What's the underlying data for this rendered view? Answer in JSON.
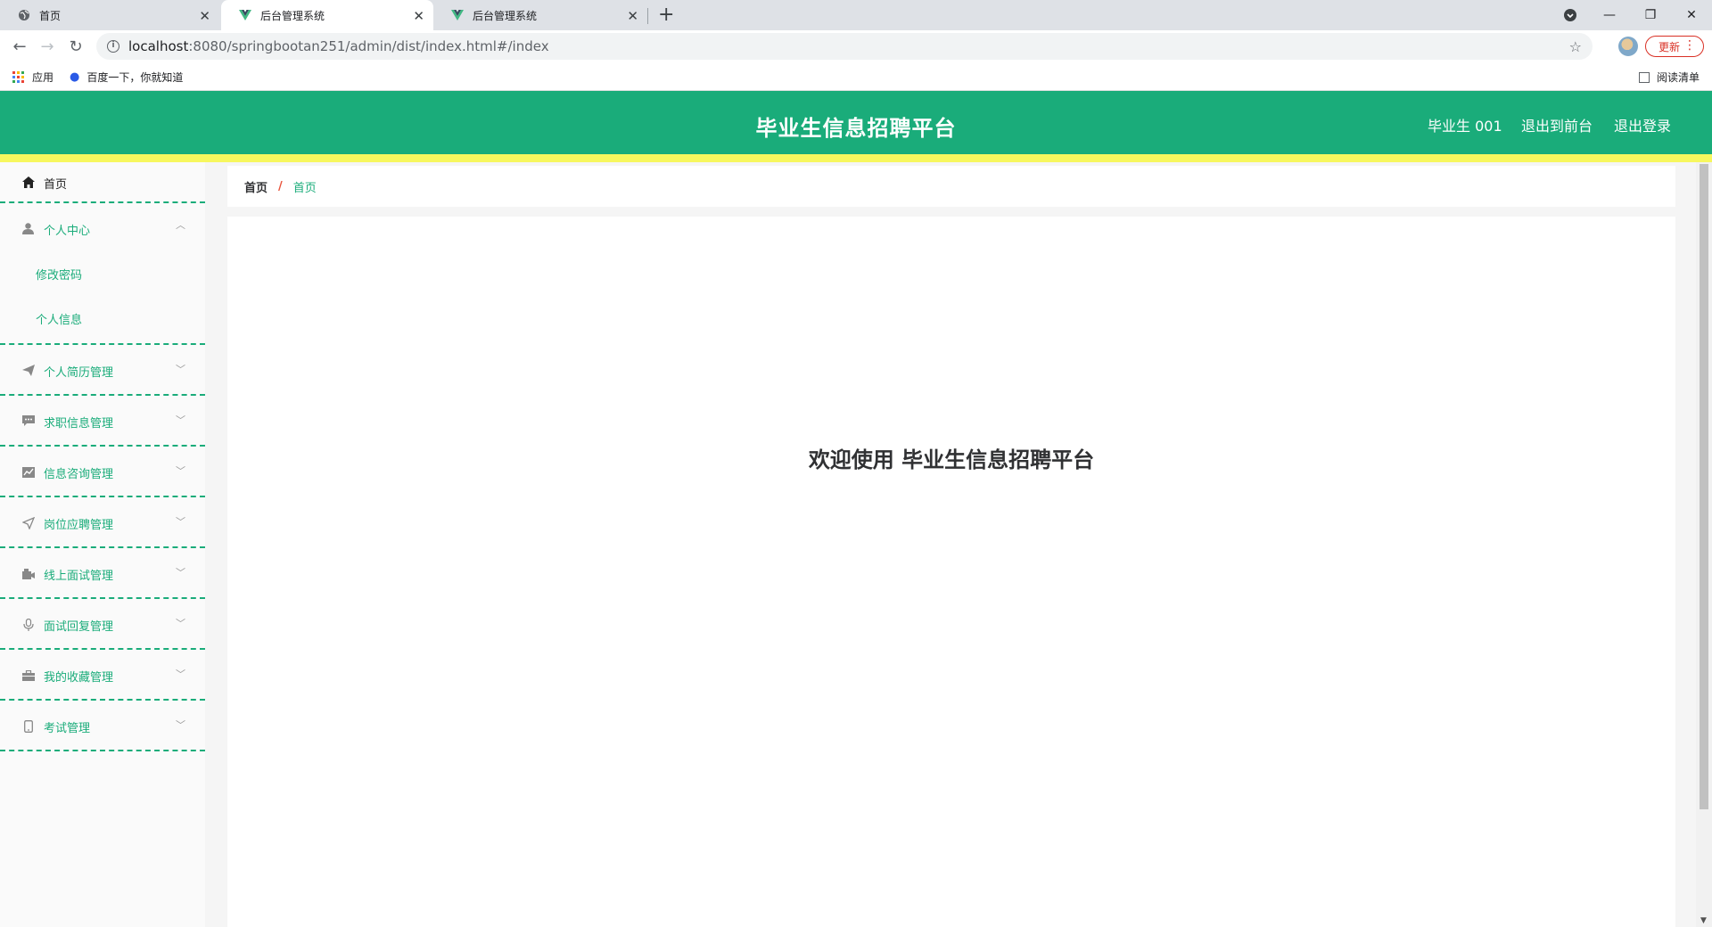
{
  "browser": {
    "tabs": [
      {
        "title": "首页",
        "favicon": "globe-icon"
      },
      {
        "title": "后台管理系统",
        "favicon": "vue-logo-icon"
      },
      {
        "title": "后台管理系统",
        "favicon": "vue-logo-icon"
      }
    ],
    "active_tab": 1,
    "address": {
      "host": "localhost",
      "path": ":8080/springbootan251/admin/dist/index.html#/index"
    },
    "update_button": "更新",
    "bookmarks": [
      {
        "label": "应用",
        "icon": "apps-grid-icon"
      },
      {
        "label": "百度一下，你就知道",
        "icon": "baidu-paw-icon"
      }
    ],
    "reading_list": "阅读清单"
  },
  "app": {
    "title": "毕业生信息招聘平台",
    "user": "毕业生 001",
    "exit_front": "退出到前台",
    "logout": "退出登录",
    "colors": {
      "primary": "#1aac7a",
      "accent_bar": "#f7f75e",
      "crumb_sep": "#e8543c"
    }
  },
  "sidebar": {
    "home": {
      "label": "首页",
      "icon": "home-icon"
    },
    "personal_center": {
      "label": "个人中心",
      "icon": "user-icon",
      "expanded": true,
      "children": [
        "修改密码",
        "个人信息"
      ]
    },
    "menus": [
      {
        "label": "个人简历管理",
        "icon": "send-icon"
      },
      {
        "label": "求职信息管理",
        "icon": "chat-icon"
      },
      {
        "label": "信息咨询管理",
        "icon": "chart-icon"
      },
      {
        "label": "岗位应聘管理",
        "icon": "navigation-icon"
      },
      {
        "label": "线上面试管理",
        "icon": "video-icon"
      },
      {
        "label": "面试回复管理",
        "icon": "microphone-icon"
      },
      {
        "label": "我的收藏管理",
        "icon": "briefcase-icon"
      },
      {
        "label": "考试管理",
        "icon": "phone-icon"
      }
    ]
  },
  "breadcrumb": {
    "home": "首页",
    "separator": "/",
    "current": "首页"
  },
  "main": {
    "welcome": "欢迎使用 毕业生信息招聘平台"
  }
}
